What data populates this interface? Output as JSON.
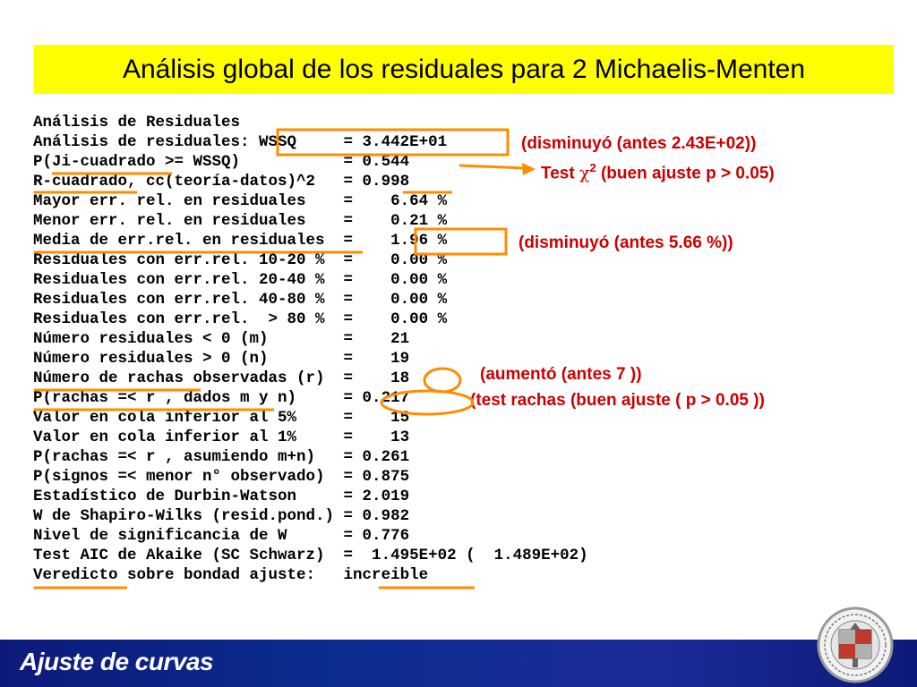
{
  "slide": {
    "title": "Análisis global de los residuales para 2 Michaelis-Menten",
    "footer": "Ajuste de curvas",
    "colors": {
      "title_bg": "#ffff00",
      "annotation": "#cc0000",
      "highlight": "#ff8c00",
      "footer_bg": "#0b2c8f"
    }
  },
  "output_lines": [
    "Análisis de Residuales",
    "Análisis de residuales: WSSQ     = 3.442E+01",
    "P(Ji-cuadrado >= WSSQ)           = 0.544",
    "R-cuadrado, cc(teoría-datos)^2   = 0.998",
    "Mayor err. rel. en residuales    =    6.64 %",
    "Menor err. rel. en residuales    =    0.21 %",
    "Media de err.rel. en residuales  =    1.96 %",
    "Residuales con err.rel. 10-20 %  =    0.00 %",
    "Residuales con err.rel. 20-40 %  =    0.00 %",
    "Residuales con err.rel. 40-80 %  =    0.00 %",
    "Residuales con err.rel.  > 80 %  =    0.00 %",
    "Número residuales < 0 (m)        =    21",
    "Número residuales > 0 (n)        =    19",
    "Número de rachas observadas (r)  =    18",
    "P(rachas =< r , dados m y n)     = 0.217",
    "Valor en cola inferior al 5%     =    15",
    "Valor en cola inferior al 1%     =    13",
    "P(rachas =< r , asumiendo m+n)   = 0.261",
    "P(signos =< menor n° observado)  = 0.875",
    "Estadístico de Durbin-Watson     = 2.019",
    "W de Shapiro-Wilks (resid.pond.) = 0.982",
    "Nivel de significancia de W      = 0.776",
    "Test AIC de Akaike (SC Schwarz)  =  1.495E+02 (  1.489E+02)",
    "Veredicto sobre bondad ajuste:   increible"
  ],
  "annotations": {
    "wssq_note": "(disminuyó (antes 2.43E+02))",
    "chi_test_prefix": "Test ",
    "chi_symbol": "χ",
    "chi_superscript": "2",
    "chi_test_suffix": " (buen ajuste p > 0.05)",
    "media_note": "(disminuyó (antes 5.66 %))",
    "rachas_note": "(aumentó (antes 7 ))",
    "rachas_test_note": "(test rachas (buen ajuste ( p > 0.05 ))"
  },
  "icons": {
    "seal": "university-seal-icon"
  }
}
